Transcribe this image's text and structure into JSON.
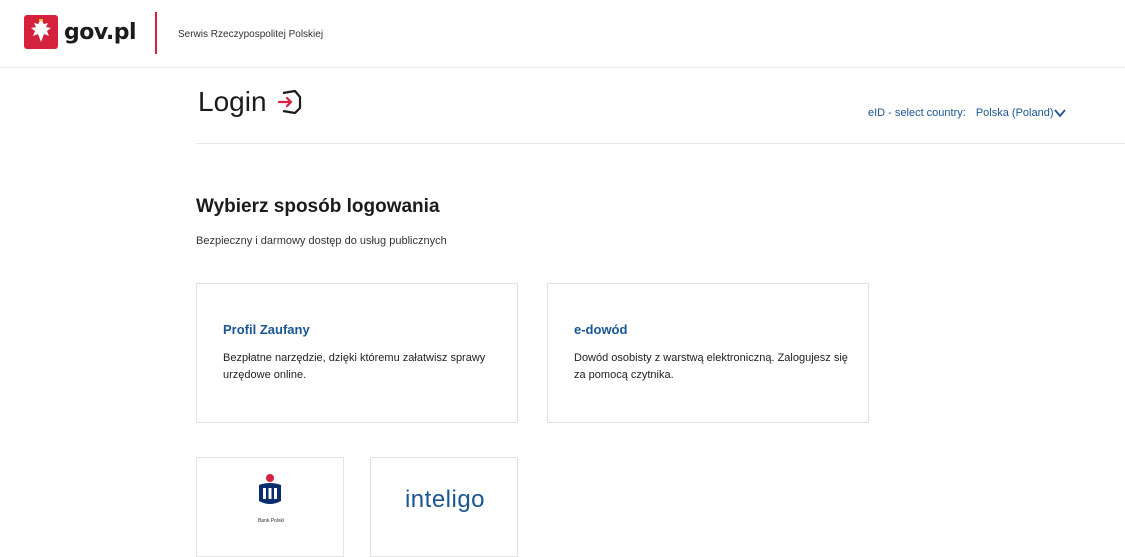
{
  "header": {
    "logo_text": "gov.pl",
    "service_name": "Serwis Rzeczypospolitej Polskiej"
  },
  "login": {
    "title": "Login",
    "eid_label": "eID - select country:",
    "eid_country": "Polska (Poland)"
  },
  "section": {
    "title": "Wybierz sposób logowania",
    "subtitle": "Bezpieczny i darmowy dostęp do usług publicznych"
  },
  "methods": [
    {
      "title": "Profil Zaufany",
      "description": "Bezpłatne narzędzie, dzięki któremu załatwisz sprawy urzędowe online."
    },
    {
      "title": "e-dowód",
      "description": "Dowód osobisty z warstwą elektroniczną. Zalogujesz się za pomocą czytnika."
    }
  ],
  "banks": [
    {
      "label": "Bank Polski",
      "icon": "pko-bank-logo"
    },
    {
      "label": "inteligo",
      "icon": "inteligo-logo"
    }
  ],
  "colors": {
    "brand_red": "#d4213d",
    "link_blue": "#1a5594",
    "text": "#1b1b1b"
  },
  "icons": [
    "polish-eagle-icon",
    "login-icon",
    "chevron-down-icon",
    "pko-bank-logo"
  ]
}
